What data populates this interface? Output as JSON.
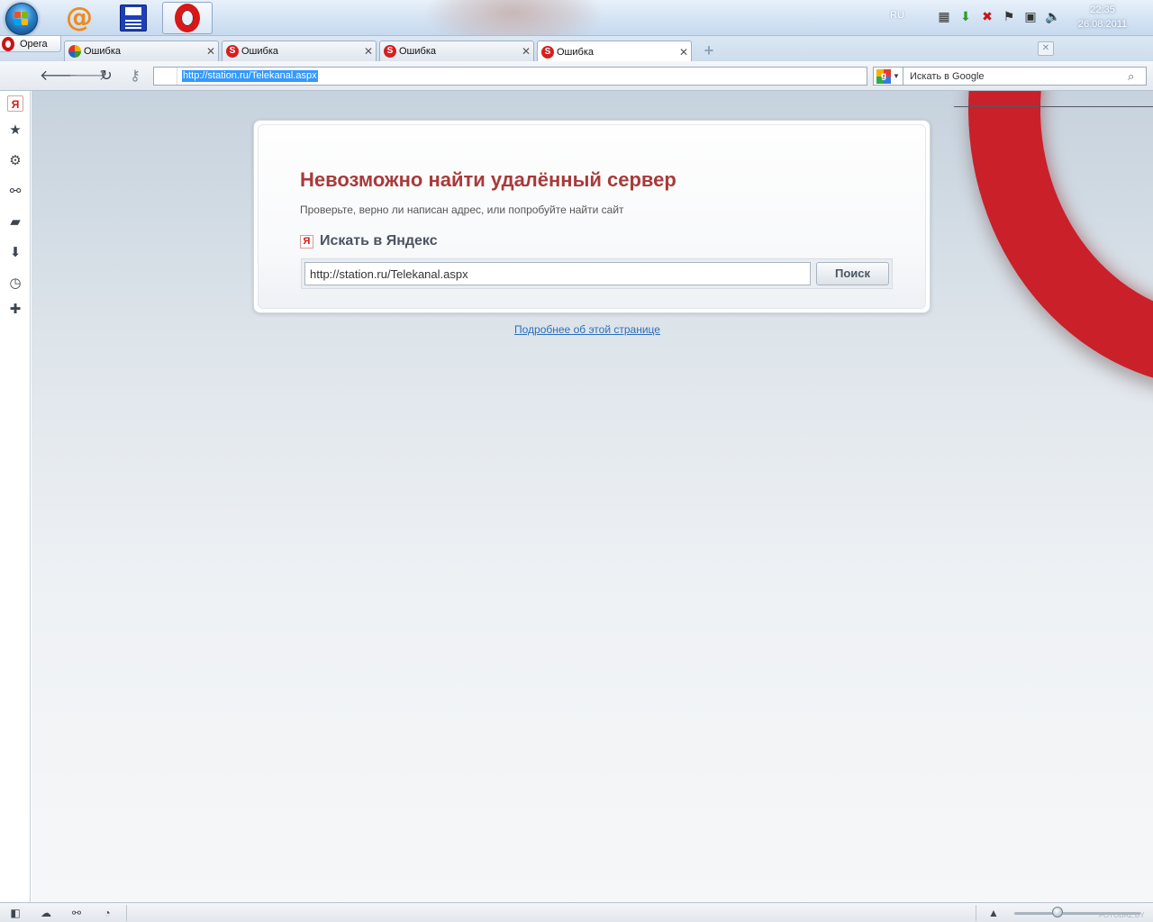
{
  "taskbar": {
    "apps": [
      {
        "name": "mail-agent",
        "icon": "at-sign-icon"
      },
      {
        "name": "save-floppy",
        "icon": "floppy-icon"
      },
      {
        "name": "opera-browser",
        "icon": "opera-icon",
        "active": true
      }
    ],
    "language": "RU",
    "clock": {
      "time": "22:35",
      "date": "26.08.2011"
    }
  },
  "browser": {
    "menu_label": "Opera",
    "tabs": [
      {
        "label": "Ошибка",
        "icon": "colorful-favicon"
      },
      {
        "label": "Ошибка",
        "icon": "red-s-favicon"
      },
      {
        "label": "Ошибка",
        "icon": "red-s-favicon"
      },
      {
        "label": "Ошибка",
        "icon": "red-s-favicon",
        "active": true
      }
    ],
    "address": "http://station.ru/Telekanal.aspx",
    "search_placeholder": "Искать в Google",
    "search_engine": "google-icon"
  },
  "sidebar": {
    "items": [
      "yandex-icon",
      "bookmarks-star-icon",
      "settings-gear-icon",
      "unite-icon",
      "notes-icon",
      "downloads-icon",
      "history-clock-icon",
      "add-panel-icon"
    ]
  },
  "error_page": {
    "title": "Невозможно найти удалённый сервер",
    "description": "Проверьте, верно ли написан адрес, или попробуйте найти сайт",
    "yandex_logo": "Я",
    "search_heading": "Искать в Яндекс",
    "search_value": "http://station.ru/Telekanal.aspx",
    "search_button": "Поиск",
    "more_link": "Подробнее об этой странице"
  },
  "statusbar": {
    "watermark": "FOTOBAZ.BY",
    "zoom_level": 0.34
  },
  "colors": {
    "accent_red": "#c9202a",
    "title_red": "#a93a3a",
    "link_blue": "#2c6fb8",
    "selection_blue": "#3399ff"
  }
}
